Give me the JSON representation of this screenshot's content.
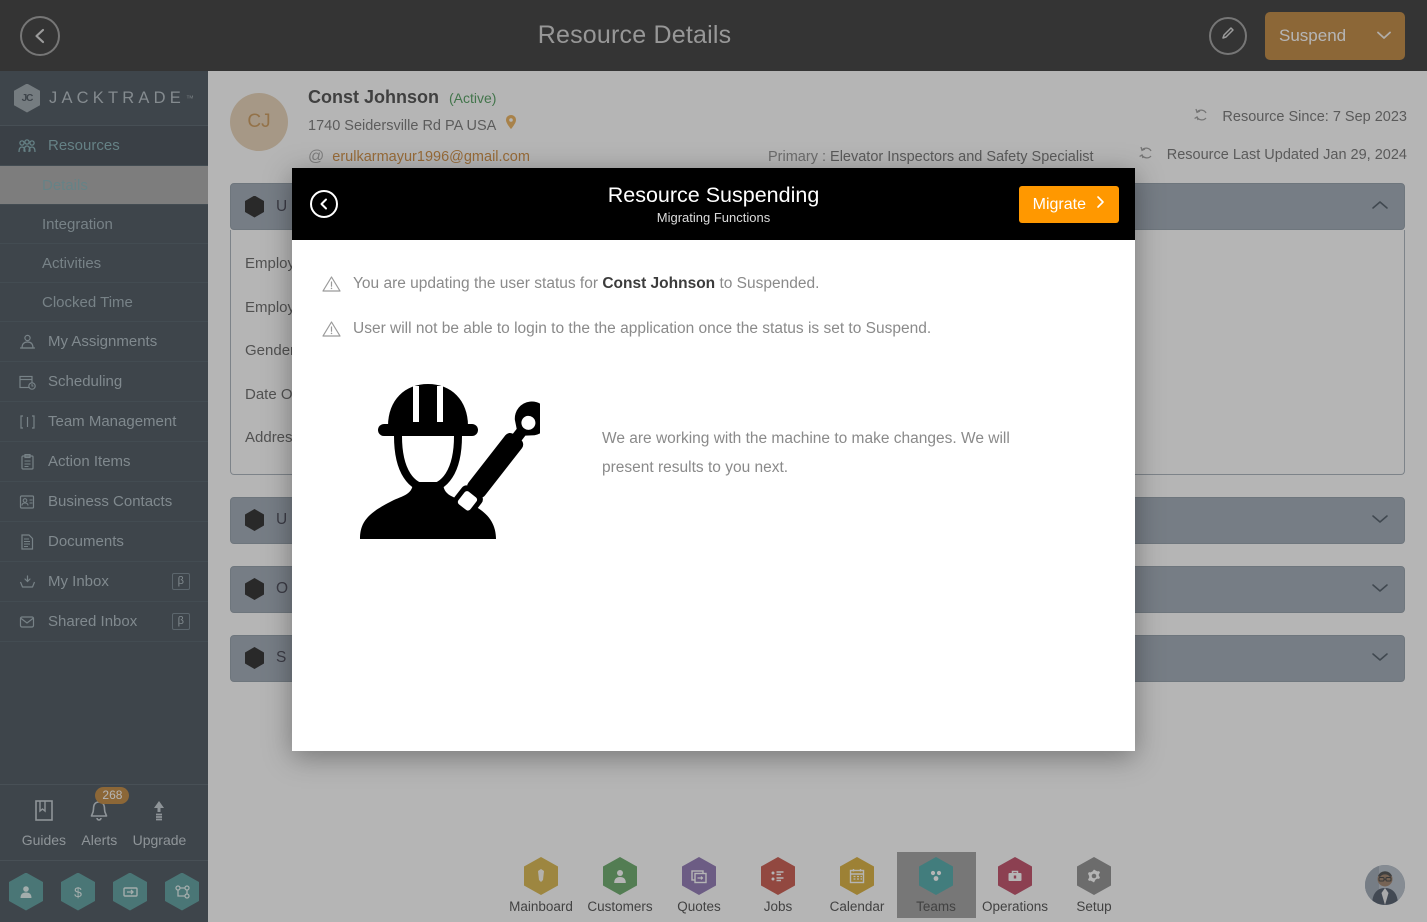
{
  "header": {
    "back_icon": "chevron-left-circle-icon",
    "title": "Resource Details",
    "edit_icon": "pencil-circle-icon",
    "suspend_label": "Suspend",
    "suspend_chevron": "⌄",
    "suspend_color": "#b5711a"
  },
  "sidebar": {
    "brand": "JACKTRADE",
    "brand_tm": "™",
    "parent": {
      "label": "Resources",
      "icon": "resources-icon"
    },
    "sub_items": [
      {
        "label": "Details",
        "active": true
      },
      {
        "label": "Integration",
        "active": false
      },
      {
        "label": "Activities",
        "active": false
      },
      {
        "label": "Clocked Time",
        "active": false
      }
    ],
    "items": [
      {
        "label": "My Assignments",
        "icon": "assignments-icon",
        "beta": ""
      },
      {
        "label": "Scheduling",
        "icon": "calendar-clock-icon",
        "beta": ""
      },
      {
        "label": "Team Management",
        "icon": "team-icon",
        "beta": ""
      },
      {
        "label": "Action Items",
        "icon": "clipboard-icon",
        "beta": ""
      },
      {
        "label": "Business Contacts",
        "icon": "contact-card-icon",
        "beta": ""
      },
      {
        "label": "Documents",
        "icon": "document-icon",
        "beta": ""
      },
      {
        "label": "My Inbox",
        "icon": "inbox-icon",
        "beta": "β"
      },
      {
        "label": "Shared Inbox",
        "icon": "envelope-icon",
        "beta": "β"
      }
    ],
    "tools": [
      {
        "label": "Guides",
        "icon": "book-icon",
        "badge": ""
      },
      {
        "label": "Alerts",
        "icon": "bell-icon",
        "badge": "268"
      },
      {
        "label": "Upgrade",
        "icon": "up-arrow-icon",
        "badge": ""
      }
    ],
    "hex_shortcuts": [
      "person-icon",
      "dollar-icon",
      "money-transfer-icon",
      "workflow-icon"
    ],
    "badge_color": "#b5711a",
    "hex_color": "#3d8c8c"
  },
  "profile": {
    "initials": "CJ",
    "name": "Const Johnson",
    "status": "(Active)",
    "address": "1740 Seidersville Rd PA USA",
    "location_icon": "map-pin-icon",
    "email": "erulkarmayur1996@gmail.com",
    "email_icon": "at-icon",
    "primary_key": "Primary :",
    "primary_value": "Elevator Inspectors and Safety Specialist",
    "resource_since": "Resource Since: 7 Sep 2023",
    "last_updated": "Resource Last Updated Jan 29, 2024",
    "refresh_icon": "refresh-icon"
  },
  "accordions": [
    {
      "label": "U",
      "expanded": true,
      "chevron": "⌃"
    },
    {
      "label": "U",
      "expanded": false,
      "chevron": "⌄"
    },
    {
      "label": "O",
      "expanded": false,
      "chevron": "⌄"
    },
    {
      "label": "S",
      "expanded": false,
      "chevron": "⌄"
    }
  ],
  "form_fields": [
    "Employe",
    "Employe",
    "Gender",
    "Date Of",
    "Address"
  ],
  "modal": {
    "back_icon": "chevron-left-circle-icon",
    "title": "Resource Suspending",
    "subtitle": "Migrating Functions",
    "action_label": "Migrate",
    "action_chevron": "›",
    "action_color": "#FF9800",
    "warnings": [
      {
        "icon": "warning-triangle-icon",
        "prefix": "You are updating the user status for ",
        "bold": "Const Johnson",
        "suffix": " to Suspended."
      },
      {
        "icon": "warning-triangle-icon",
        "prefix": "User will not be able to login to the the application once the status is set to Suspend.",
        "bold": "",
        "suffix": ""
      }
    ],
    "illustration_icon": "worker-with-wrench-icon",
    "body_text": "We are working with the machine to make changes. We will present results to you next."
  },
  "bottom_nav": {
    "items": [
      {
        "label": "Mainboard",
        "icon": "mainboard-icon",
        "color": "#d4aa2a",
        "active": false
      },
      {
        "label": "Customers",
        "icon": "customers-icon",
        "color": "#4e9a4e",
        "active": false
      },
      {
        "label": "Quotes",
        "icon": "quotes-icon",
        "color": "#7b5ea7",
        "active": false
      },
      {
        "label": "Jobs",
        "icon": "jobs-icon",
        "color": "#c0392b",
        "active": false
      },
      {
        "label": "Calendar",
        "icon": "calendar-icon",
        "color": "#d4a017",
        "active": false
      },
      {
        "label": "Teams",
        "icon": "teams-icon",
        "color": "#2f9a9a",
        "active": true
      },
      {
        "label": "Operations",
        "icon": "operations-icon",
        "color": "#b52a4a",
        "active": false
      },
      {
        "label": "Setup",
        "icon": "setup-icon",
        "color": "#7a7a7a",
        "active": false
      }
    ],
    "avatar_icon": "user-avatar-photo"
  }
}
